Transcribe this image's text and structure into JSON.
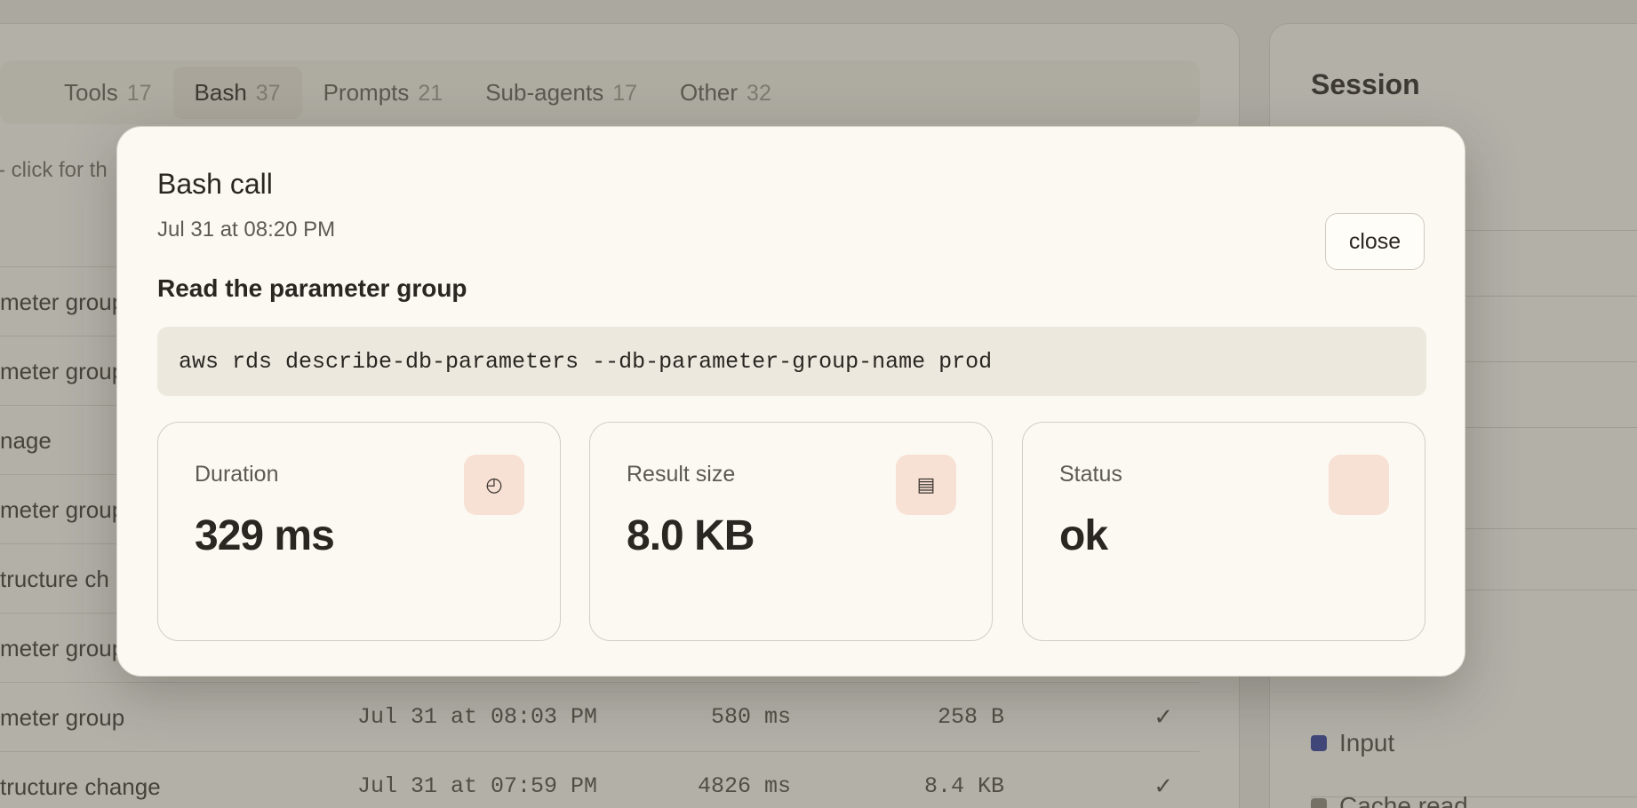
{
  "tabs": [
    {
      "label": "Tools",
      "count": "17"
    },
    {
      "label": "Bash",
      "count": "37"
    },
    {
      "label": "Prompts",
      "count": "21"
    },
    {
      "label": "Sub-agents",
      "count": "17"
    },
    {
      "label": "Other",
      "count": "32"
    }
  ],
  "hint": "- click for th",
  "rows": [
    {
      "name": "meter group",
      "time": "",
      "duration": "",
      "size": "",
      "status": ""
    },
    {
      "name": "meter group",
      "time": "",
      "duration": "",
      "size": "",
      "status": ""
    },
    {
      "name": "nage",
      "time": "",
      "duration": "",
      "size": "",
      "status": ""
    },
    {
      "name": "meter group",
      "time": "",
      "duration": "",
      "size": "",
      "status": ""
    },
    {
      "name": "tructure ch",
      "time": "",
      "duration": "",
      "size": "",
      "status": ""
    },
    {
      "name": "meter group",
      "time": "",
      "duration": "",
      "size": "",
      "status": ""
    },
    {
      "name": "meter group",
      "time": "Jul 31 at 08:03 PM",
      "duration": "580 ms",
      "size": "258 B",
      "status": "✓"
    },
    {
      "name": "tructure change",
      "time": "Jul 31 at 07:59 PM",
      "duration": "4826 ms",
      "size": "8.4 KB",
      "status": "✓"
    }
  ],
  "session": {
    "title": "Session",
    "legend": [
      {
        "label": "Input",
        "color": "#2f3f9a"
      },
      {
        "label": "Cache read",
        "color": "#8a857b"
      }
    ]
  },
  "modal": {
    "title": "Bash call",
    "date": "Jul 31 at 08:20 PM",
    "close_label": "close",
    "description": "Read the parameter group",
    "command": "aws rds describe-db-parameters --db-parameter-group-name prod",
    "cards": [
      {
        "label": "Duration",
        "value": "329 ms",
        "icon": "clock-icon",
        "glyph": "◴"
      },
      {
        "label": "Result size",
        "value": "8.0 KB",
        "icon": "document-icon",
        "glyph": "▤"
      },
      {
        "label": "Status",
        "value": "ok",
        "icon": "status-icon",
        "glyph": ""
      }
    ]
  }
}
